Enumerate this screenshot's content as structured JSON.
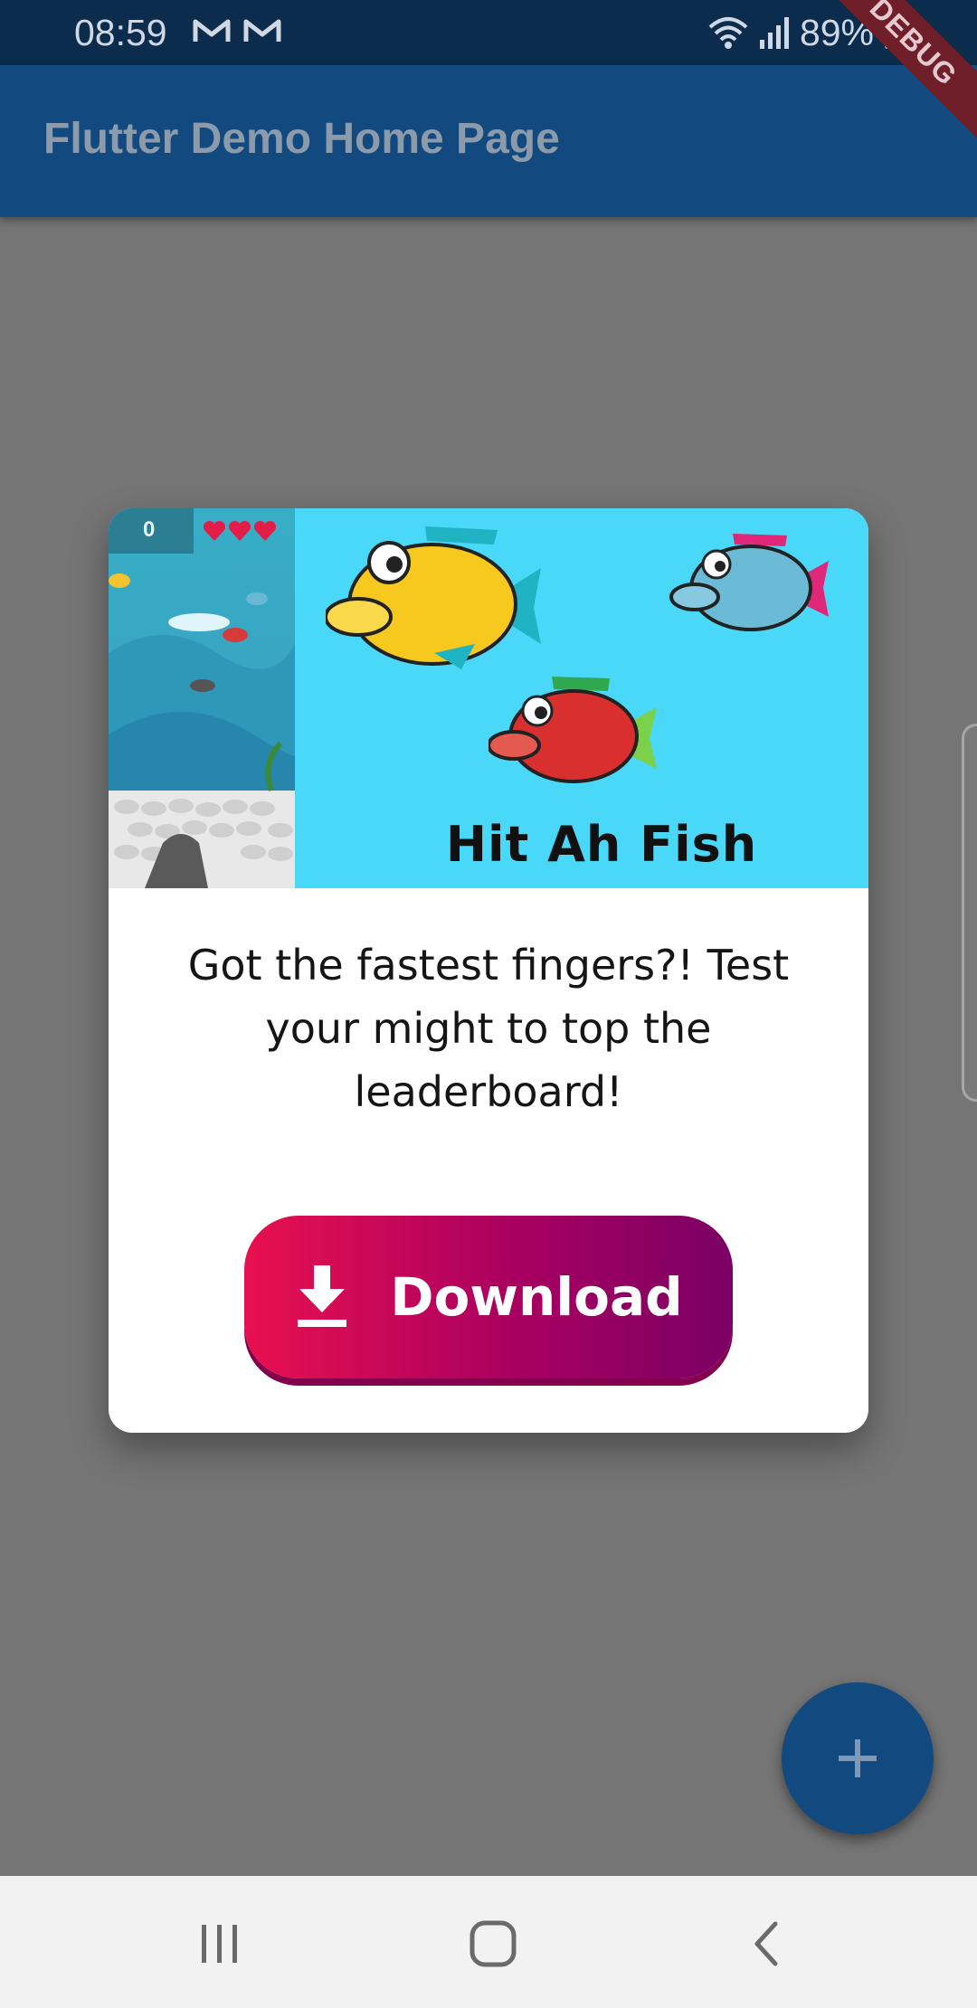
{
  "status_bar": {
    "time": "08:59",
    "notification_icons": [
      "gmail-icon",
      "gmail-icon"
    ],
    "battery_percent": "89%",
    "icons": [
      "wifi-icon",
      "signal-icon",
      "battery-charging-icon"
    ]
  },
  "app_bar": {
    "title": "Flutter Demo Home Page",
    "debug_banner": "DEBUG"
  },
  "dialog": {
    "banner_title": "Hit Ah Fish",
    "game_hud_score": "0",
    "message": "Got the fastest fingers?! Test your might to top the leaderboard!",
    "download_button": {
      "label": "Download",
      "icon": "download-icon",
      "gradient_start": "#e8104f",
      "gradient_end": "#7a0064"
    }
  },
  "fab": {
    "icon": "plus-icon",
    "color": "#124a80"
  },
  "nav_bar": {
    "buttons": [
      "recent-apps-icon",
      "home-icon",
      "back-icon"
    ]
  },
  "colors": {
    "scrim": "#757575",
    "app_bar": "#124a80",
    "status_bar": "#0b2c4d",
    "banner_background": "#4ad8f8"
  }
}
